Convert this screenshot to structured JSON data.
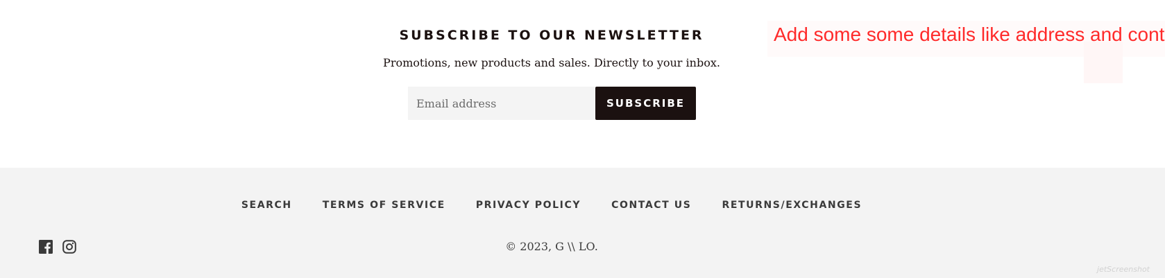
{
  "newsletter": {
    "title": "SUBSCRIBE TO OUR NEWSLETTER",
    "subtitle": "Promotions, new products and sales. Directly to your inbox.",
    "email_placeholder": "Email address",
    "subscribe_label": "SUBSCRIBE"
  },
  "annotation": {
    "text": "Add some some details like address and conta"
  },
  "footer": {
    "nav": [
      {
        "label": "SEARCH"
      },
      {
        "label": "TERMS OF SERVICE"
      },
      {
        "label": "PRIVACY POLICY"
      },
      {
        "label": "CONTACT US"
      },
      {
        "label": "RETURNS/EXCHANGES"
      }
    ],
    "social": [
      {
        "icon": "facebook-icon"
      },
      {
        "icon": "instagram-icon"
      }
    ],
    "copyright": "© 2023, G \\\\ LO."
  },
  "watermark": "jetScreenshot",
  "colors": {
    "accent": "#1b1110",
    "footer_bg": "#f3f3f3",
    "annotation_red": "#ff2a2a"
  }
}
